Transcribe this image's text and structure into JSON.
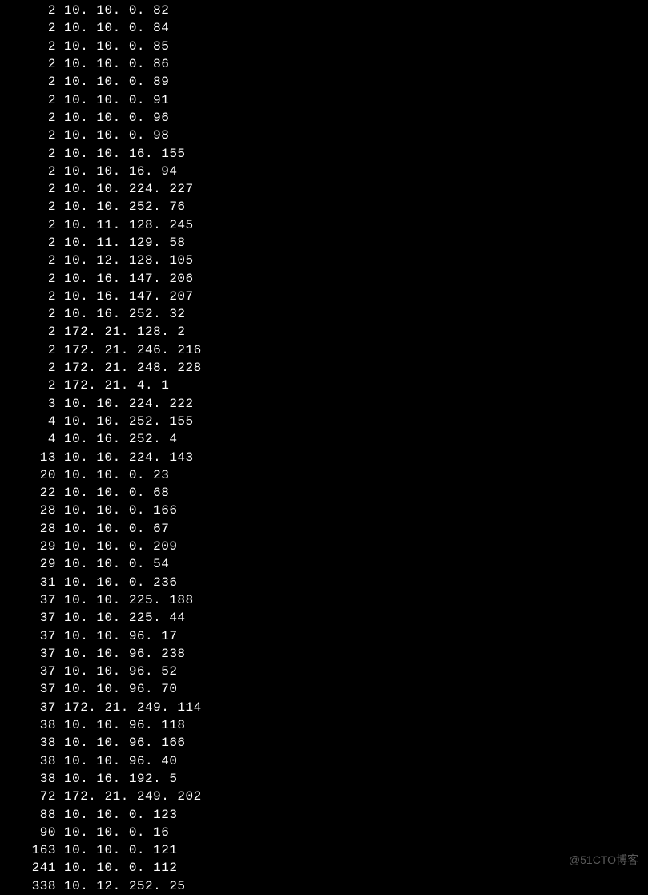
{
  "rows": [
    {
      "count": "2",
      "ip": "10. 10. 0. 82"
    },
    {
      "count": "2",
      "ip": "10. 10. 0. 84"
    },
    {
      "count": "2",
      "ip": "10. 10. 0. 85"
    },
    {
      "count": "2",
      "ip": "10. 10. 0. 86"
    },
    {
      "count": "2",
      "ip": "10. 10. 0. 89"
    },
    {
      "count": "2",
      "ip": "10. 10. 0. 91"
    },
    {
      "count": "2",
      "ip": "10. 10. 0. 96"
    },
    {
      "count": "2",
      "ip": "10. 10. 0. 98"
    },
    {
      "count": "2",
      "ip": "10. 10. 16. 155"
    },
    {
      "count": "2",
      "ip": "10. 10. 16. 94"
    },
    {
      "count": "2",
      "ip": "10. 10. 224. 227"
    },
    {
      "count": "2",
      "ip": "10. 10. 252. 76"
    },
    {
      "count": "2",
      "ip": "10. 11. 128. 245"
    },
    {
      "count": "2",
      "ip": "10. 11. 129. 58"
    },
    {
      "count": "2",
      "ip": "10. 12. 128. 105"
    },
    {
      "count": "2",
      "ip": "10. 16. 147. 206"
    },
    {
      "count": "2",
      "ip": "10. 16. 147. 207"
    },
    {
      "count": "2",
      "ip": "10. 16. 252. 32"
    },
    {
      "count": "2",
      "ip": "172. 21. 128. 2"
    },
    {
      "count": "2",
      "ip": "172. 21. 246. 216"
    },
    {
      "count": "2",
      "ip": "172. 21. 248. 228"
    },
    {
      "count": "2",
      "ip": "172. 21. 4. 1"
    },
    {
      "count": "3",
      "ip": "10. 10. 224. 222"
    },
    {
      "count": "4",
      "ip": "10. 10. 252. 155"
    },
    {
      "count": "4",
      "ip": "10. 16. 252. 4"
    },
    {
      "count": "13",
      "ip": "10. 10. 224. 143"
    },
    {
      "count": "20",
      "ip": "10. 10. 0. 23"
    },
    {
      "count": "22",
      "ip": "10. 10. 0. 68"
    },
    {
      "count": "28",
      "ip": "10. 10. 0. 166"
    },
    {
      "count": "28",
      "ip": "10. 10. 0. 67"
    },
    {
      "count": "29",
      "ip": "10. 10. 0. 209"
    },
    {
      "count": "29",
      "ip": "10. 10. 0. 54"
    },
    {
      "count": "31",
      "ip": "10. 10. 0. 236"
    },
    {
      "count": "37",
      "ip": "10. 10. 225. 188"
    },
    {
      "count": "37",
      "ip": "10. 10. 225. 44"
    },
    {
      "count": "37",
      "ip": "10. 10. 96. 17"
    },
    {
      "count": "37",
      "ip": "10. 10. 96. 238"
    },
    {
      "count": "37",
      "ip": "10. 10. 96. 52"
    },
    {
      "count": "37",
      "ip": "10. 10. 96. 70"
    },
    {
      "count": "37",
      "ip": "172. 21. 249. 114"
    },
    {
      "count": "38",
      "ip": "10. 10. 96. 118"
    },
    {
      "count": "38",
      "ip": "10. 10. 96. 166"
    },
    {
      "count": "38",
      "ip": "10. 10. 96. 40"
    },
    {
      "count": "38",
      "ip": "10. 16. 192. 5"
    },
    {
      "count": "72",
      "ip": "172. 21. 249. 202"
    },
    {
      "count": "88",
      "ip": "10. 10. 0. 123"
    },
    {
      "count": "90",
      "ip": "10. 10. 0. 16"
    },
    {
      "count": "163",
      "ip": "10. 10. 0. 121"
    },
    {
      "count": "241",
      "ip": "10. 10. 0. 112"
    },
    {
      "count": "338",
      "ip": "10. 12. 252. 25"
    }
  ],
  "watermark": "@51CTO博客"
}
